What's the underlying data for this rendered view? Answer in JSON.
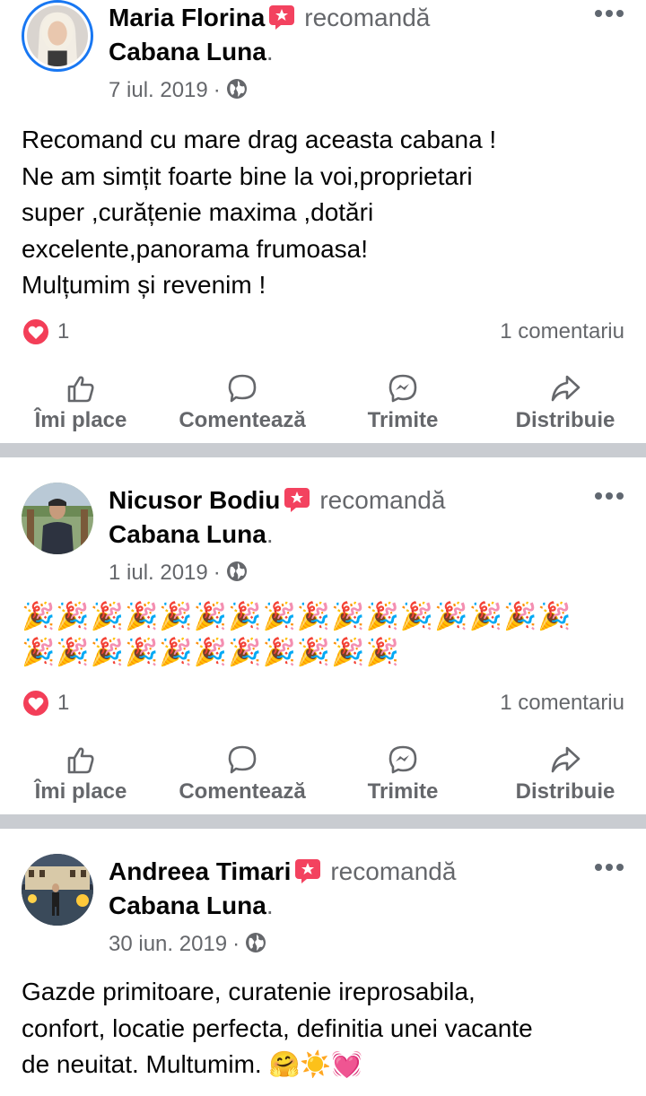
{
  "posts": [
    {
      "author": "Maria Florina",
      "verb": "recomandă",
      "page": "Cabana Luna",
      "page_suffix": ".",
      "date": "7 iul. 2019",
      "meta_sep": "·",
      "text_lines": [
        "Recomand cu mare drag aceasta cabana !",
        "Ne am simțit foarte bine la voi,proprietari",
        "super ,curățenie maxima ,dotări",
        "excelente,panorama frumoasa!",
        "Mulțumim și revenim !"
      ],
      "reactions": "1",
      "comments": "1 comentariu"
    },
    {
      "author": "Nicusor Bodiu",
      "verb": "recomandă",
      "page": "Cabana Luna",
      "page_suffix": ".",
      "date": "1 iul. 2019",
      "meta_sep": "·",
      "emoji_rows": [
        "🎉🎉🎉🎉🎉🎉🎉🎉🎉🎉🎉🎉🎉🎉🎉🎉",
        "🎉🎉🎉🎉🎉🎉🎉🎉🎉🎉🎉"
      ],
      "reactions": "1",
      "comments": "1 comentariu"
    },
    {
      "author": "Andreea Timari",
      "verb": "recomandă",
      "page": "Cabana Luna",
      "page_suffix": ".",
      "date": "30 iun. 2019",
      "meta_sep": "·",
      "text_lines": [
        "Gazde primitoare, curatenie ireprosabila,",
        "confort, locatie perfecta, definitia unei vacante",
        "de neuitat. Multumim. 🤗☀️💓"
      ]
    }
  ],
  "actions": {
    "like": "Îmi place",
    "comment": "Comentează",
    "send": "Trimite",
    "share": "Distribuie"
  },
  "icons": {
    "recommend": "recommend-badge-icon",
    "audience": "globe-icon",
    "more": "more-options-icon",
    "reaction": "love-heart-icon",
    "like": "thumbs-up-icon",
    "comment": "comment-bubble-icon",
    "send": "messenger-icon",
    "share": "share-arrow-icon"
  },
  "colors": {
    "accent": "#1877f2",
    "recommend_badge": "#f3425f",
    "secondary_text": "#65676b",
    "divider": "#c9ccd1",
    "heart": "#f33e58"
  }
}
